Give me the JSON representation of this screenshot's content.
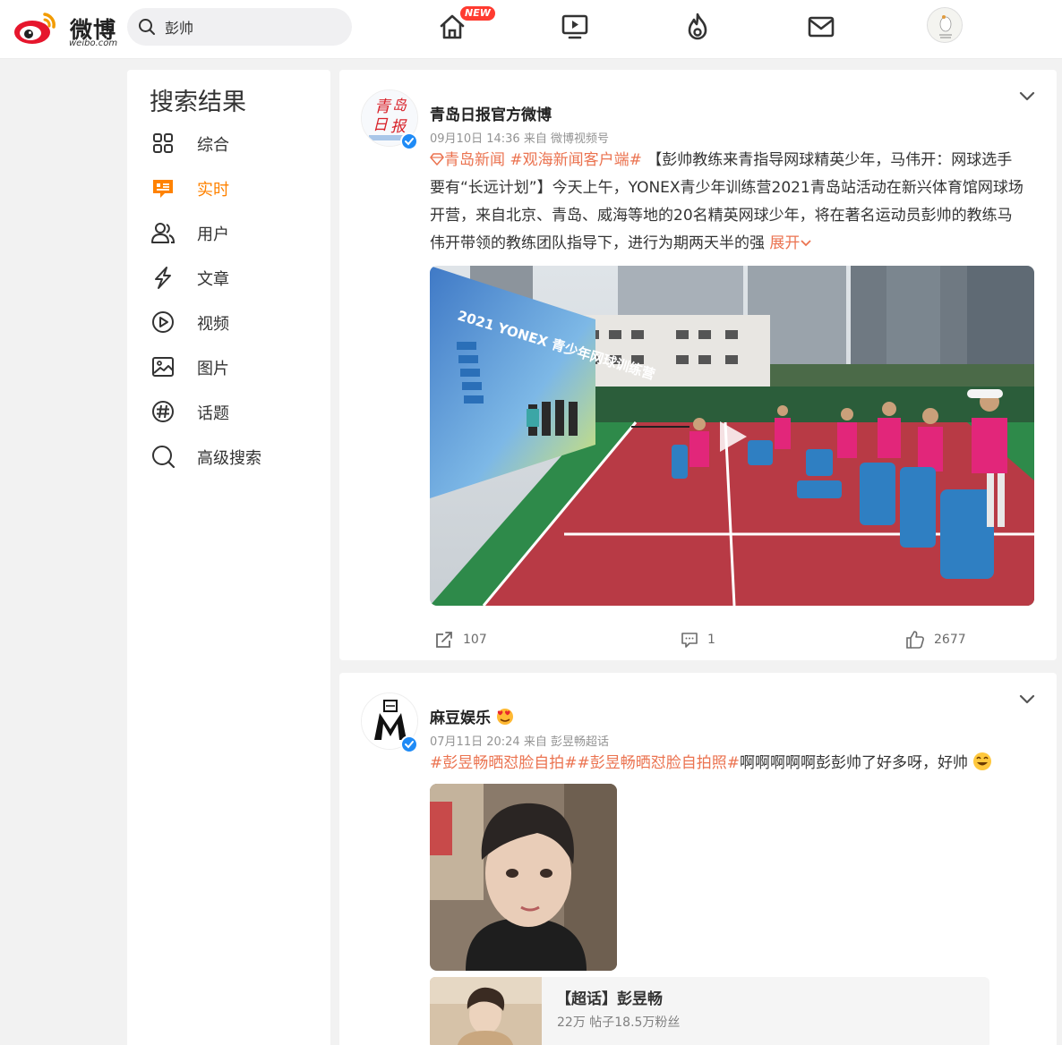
{
  "header": {
    "logo_text": "微博",
    "logo_sub": "weibo.com",
    "search_value": "彭帅",
    "new_badge": "NEW",
    "nav_icons": [
      "home-icon",
      "video-icon",
      "hot-icon",
      "message-icon"
    ]
  },
  "sidebar": {
    "title": "搜索结果",
    "items": [
      {
        "label": "综合",
        "icon": "grid-icon",
        "active": false
      },
      {
        "label": "实时",
        "icon": "realtime-icon",
        "active": true
      },
      {
        "label": "用户",
        "icon": "users-icon",
        "active": false
      },
      {
        "label": "文章",
        "icon": "article-icon",
        "active": false
      },
      {
        "label": "视频",
        "icon": "video-play-icon",
        "active": false
      },
      {
        "label": "图片",
        "icon": "image-icon",
        "active": false
      },
      {
        "label": "话题",
        "icon": "hashtag-icon",
        "active": false
      },
      {
        "label": "高级搜索",
        "icon": "search-icon",
        "active": false
      }
    ]
  },
  "posts": [
    {
      "author": "青岛日报官方微博",
      "avatar_text": "青岛日报",
      "meta": "09月10日 14:36  来自 微博视频号",
      "tag1": "青岛新闻",
      "tag2": "#观海新闻客户端#",
      "text_line1": " 【彭帅教练来青指导网球精英少年，马伟开：网球选手",
      "text_line2": "要有“长远计划”】今天上午，YONEX青少年训练营2021青岛站活动在新兴体育馆网球场",
      "text_line3": "开营，来自北京、青岛、威海等地的20名精英网球少年，将在著名运动员彭帅的教练马",
      "text_line4": "伟开带领的教练团队指导下，进行为期两天半的强 ",
      "expand": "展开",
      "video_banner": "2021 YONEX 青少年网球训练营",
      "reposts": "107",
      "comments": "1",
      "likes": "2677"
    },
    {
      "author": "麻豆娱乐",
      "meta": "07月11日 20:24  来自 彭昱畅超话",
      "tag1": "#彭昱畅晒怼脸自拍#",
      "tag2": "#彭昱畅晒怼脸自拍照#",
      "text": "啊啊啊啊啊彭彭帅了好多呀，好帅",
      "topic_title": "【超话】彭昱畅",
      "topic_stat": "22万 帖子18.5万粉丝"
    }
  ],
  "colors": {
    "accent": "#ff8200",
    "tag": "#eb7350",
    "verified": "#1f8bf6",
    "court_red": "#b83a45",
    "court_green": "#2e8a4a"
  }
}
